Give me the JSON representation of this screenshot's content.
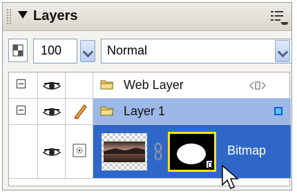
{
  "panel": {
    "title": "Layers"
  },
  "controls": {
    "opacity_value": "100",
    "blend_mode": "Normal"
  },
  "layers": [
    {
      "name": "Web Layer"
    },
    {
      "name": "Layer 1"
    },
    {
      "name": "Bitmap"
    }
  ],
  "colors": {
    "selection": "#2f67c9",
    "layer_row_highlight": "#9cb8e6",
    "mask_border": "#f7e41d"
  }
}
